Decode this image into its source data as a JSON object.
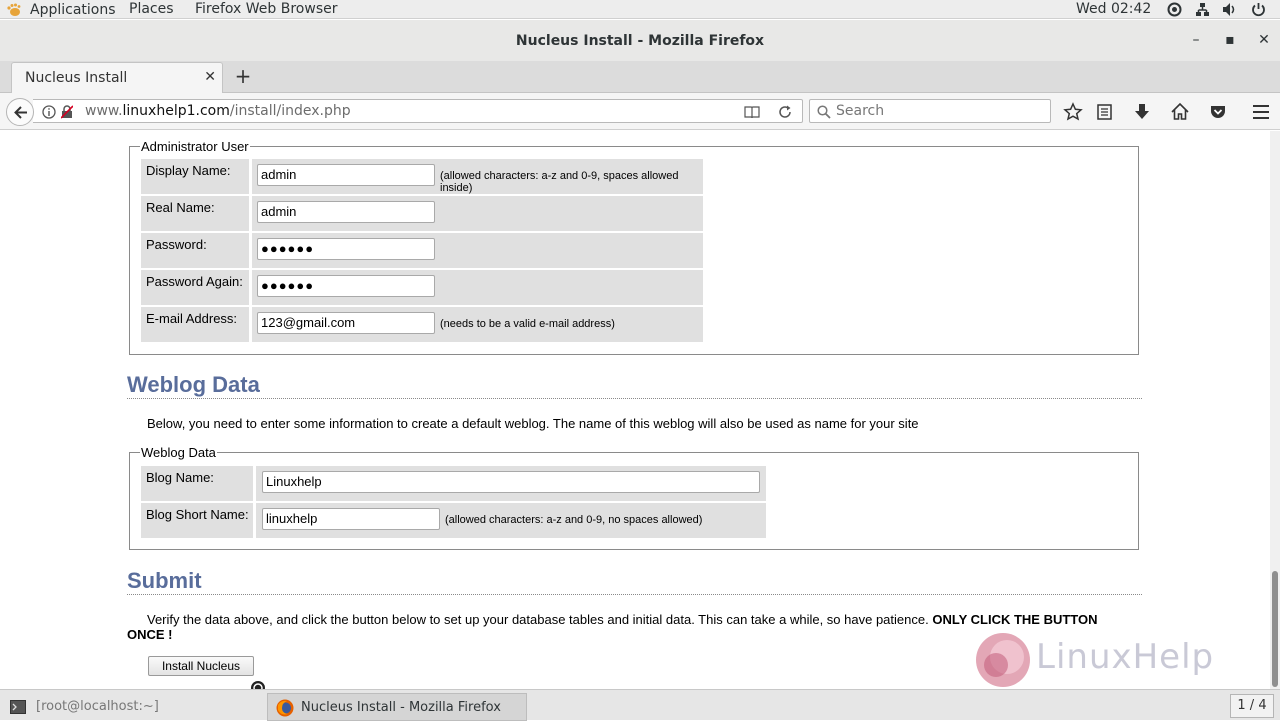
{
  "topbar": {
    "applications": "Applications",
    "places": "Places",
    "app_menu": "Firefox Web Browser",
    "clock": "Wed 02:42"
  },
  "window": {
    "title": "Nucleus Install - Mozilla Firefox"
  },
  "tabs": [
    {
      "label": "Nucleus Install"
    }
  ],
  "navbar": {
    "url_prefix": "www.",
    "url_domain": "linuxhelp1.com",
    "url_path": "/install/index.php",
    "search_placeholder": "Search"
  },
  "admin": {
    "legend": "Administrator User",
    "rows": [
      {
        "label": "Display Name:",
        "value": "admin",
        "hint": "(allowed characters: a-z and 0-9, spaces allowed inside)"
      },
      {
        "label": "Real Name:",
        "value": "admin",
        "hint": ""
      },
      {
        "label": "Password:",
        "value": "●●●●●●",
        "hint": ""
      },
      {
        "label": "Password Again:",
        "value": "●●●●●●",
        "hint": ""
      },
      {
        "label": "E-mail Address:",
        "value": "123@gmail.com",
        "hint": "(needs to be a valid e-mail address)"
      }
    ]
  },
  "weblog": {
    "heading": "Weblog Data",
    "intro": "Below, you need to enter some information to create a default weblog. The name of this weblog will also be used as name for your site",
    "legend": "Weblog Data",
    "blog_name_label": "Blog Name:",
    "blog_name_value": "Linuxhelp",
    "blog_short_label": "Blog Short Name:",
    "blog_short_value": "linuxhelp",
    "blog_short_hint": "(allowed characters: a-z and 0-9, no spaces allowed)"
  },
  "submit": {
    "heading": "Submit",
    "text": "Verify the data above, and click the button below to set up your database tables and initial data. This can take a while, so have patience.",
    "warning_line1": "ONLY CLICK THE BUTTON",
    "warning_line2": "ONCE !",
    "button": "Install Nucleus"
  },
  "watermark": {
    "text": "LinuxHelp"
  },
  "taskbar": {
    "terminal": "[root@localhost:~]",
    "firefox": "Nucleus Install - Mozilla Firefox",
    "workspace": "1 / 4"
  },
  "colors": {
    "heading": "#596d9b",
    "row_bg": "#e0e0e0"
  }
}
